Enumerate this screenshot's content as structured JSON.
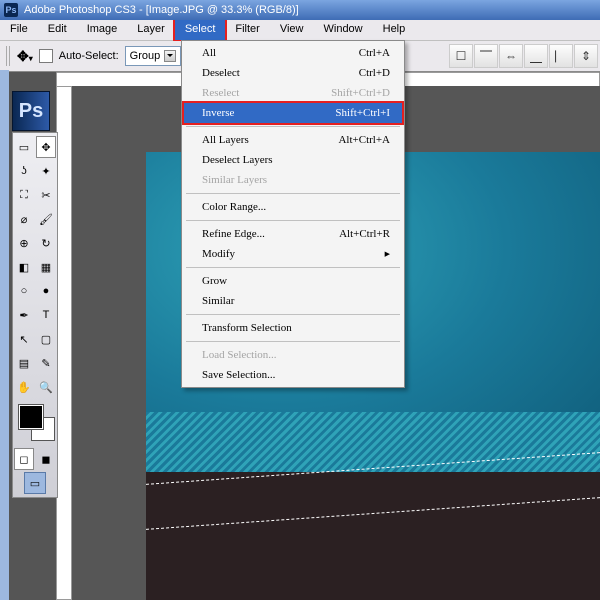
{
  "titlebar": {
    "app": "Adobe Photoshop CS3",
    "doc": "[Image.JPG @ 33.3% (RGB/8)]"
  },
  "menubar": {
    "items": [
      "File",
      "Edit",
      "Image",
      "Layer",
      "Select",
      "Filter",
      "View",
      "Window",
      "Help"
    ],
    "open_index": 4
  },
  "options": {
    "auto_select": "Auto-Select:",
    "group": "Group"
  },
  "select_menu": [
    {
      "label": "All",
      "sc": "Ctrl+A"
    },
    {
      "label": "Deselect",
      "sc": "Ctrl+D"
    },
    {
      "label": "Reselect",
      "sc": "Shift+Ctrl+D",
      "dis": true
    },
    {
      "label": "Inverse",
      "sc": "Shift+Ctrl+I",
      "hl": true
    },
    {
      "sep": true
    },
    {
      "label": "All Layers",
      "sc": "Alt+Ctrl+A"
    },
    {
      "label": "Deselect Layers"
    },
    {
      "label": "Similar Layers",
      "dis": true
    },
    {
      "sep": true
    },
    {
      "label": "Color Range..."
    },
    {
      "sep": true
    },
    {
      "label": "Refine Edge...",
      "sc": "Alt+Ctrl+R"
    },
    {
      "label": "Modify",
      "sub": true
    },
    {
      "sep": true
    },
    {
      "label": "Grow"
    },
    {
      "label": "Similar"
    },
    {
      "sep": true
    },
    {
      "label": "Transform Selection"
    },
    {
      "sep": true
    },
    {
      "label": "Load Selection...",
      "dis": true
    },
    {
      "label": "Save Selection..."
    }
  ],
  "ps_label": "Ps"
}
